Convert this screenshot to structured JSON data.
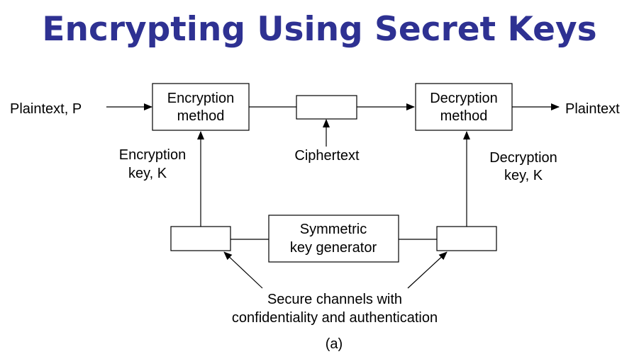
{
  "title": "Encrypting Using Secret Keys",
  "diagram": {
    "plaintext_in": "Plaintext, P",
    "encryption_method": [
      "Encryption",
      "method"
    ],
    "decryption_method": [
      "Decryption",
      "method"
    ],
    "plaintext_out": "Plaintext",
    "ciphertext": "Ciphertext",
    "encryption_key": [
      "Encryption",
      "key, K"
    ],
    "decryption_key": [
      "Decryption",
      "key, K"
    ],
    "key_generator": [
      "Symmetric",
      "key generator"
    ],
    "secure_channels": [
      "Secure channels with",
      "confidentiality and authentication"
    ],
    "caption": "(a)"
  }
}
